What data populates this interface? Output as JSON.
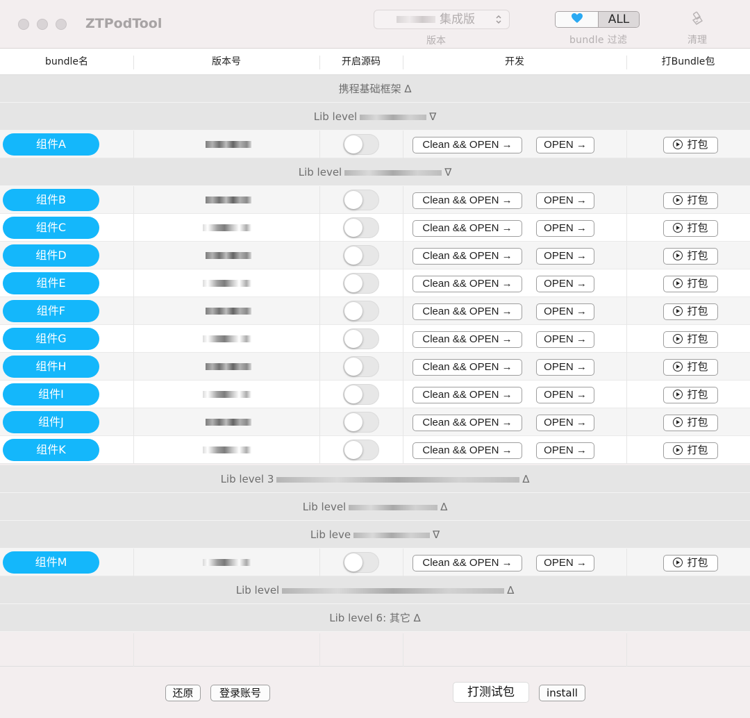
{
  "window": {
    "title": "ZTPodTool"
  },
  "toolbar": {
    "version_value": "集成版",
    "version_label": "版本",
    "filter_all": "ALL",
    "filter_label": "bundle 过滤",
    "clean_label": "清理"
  },
  "columns": [
    "bundle名",
    "版本号",
    "开启源码",
    "开发",
    "打Bundle包"
  ],
  "actions": {
    "clean_open": "Clean && OPEN →",
    "open": "OPEN →",
    "pack": "打包"
  },
  "groups": {
    "g0": "携程基础框架 ∆",
    "g1": "Lib level",
    "g1_arrow": "∇",
    "g2": "Lib level",
    "g2_arrow": "∇",
    "g3": "Lib level 3",
    "g3_arrow": "∆",
    "g4": "Lib level",
    "g4_arrow": "∆",
    "g5": "Lib leve",
    "g5_arrow": "∇",
    "g6": "Lib level",
    "g6_arrow": "∆",
    "g7": "Lib level 6: 其它 ∆"
  },
  "bundles": {
    "a": "组件A",
    "b": "组件B",
    "c": "组件C",
    "d": "组件D",
    "e": "组件E",
    "f": "组件F",
    "g": "组件G",
    "h": "组件H",
    "i": "组件I",
    "j": "组件J",
    "k": "组件K",
    "m": "组件M"
  },
  "footer": {
    "restore": "还原",
    "login": "登录账号",
    "test_pack": "打测试包",
    "install": "install"
  },
  "colors": {
    "accent": "#14b7fb",
    "heart": "#2aa9f2"
  }
}
